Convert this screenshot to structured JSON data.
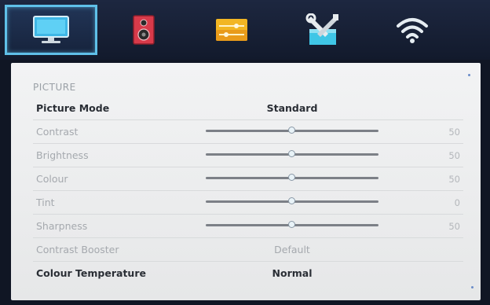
{
  "tabs": [
    {
      "icon": "monitor-icon",
      "active": true
    },
    {
      "icon": "speaker-icon",
      "active": false
    },
    {
      "icon": "equalizer-icon",
      "active": false
    },
    {
      "icon": "tools-icon",
      "active": false
    },
    {
      "icon": "wifi-icon",
      "active": false
    }
  ],
  "colors": {
    "accent": "#5fc0e8",
    "panel_bg": "#f0f1f2"
  },
  "section_title": "PICTURE",
  "picture_mode": {
    "label": "Picture Mode",
    "value": "Standard"
  },
  "sliders": [
    {
      "label": "Contrast",
      "value": "50",
      "fraction": 0.5
    },
    {
      "label": "Brightness",
      "value": "50",
      "fraction": 0.5
    },
    {
      "label": "Colour",
      "value": "50",
      "fraction": 0.5
    },
    {
      "label": "Tint",
      "value": "0",
      "fraction": 0.5
    },
    {
      "label": "Sharpness",
      "value": "50",
      "fraction": 0.5
    }
  ],
  "contrast_booster": {
    "label": "Contrast Booster",
    "value": "Default"
  },
  "colour_temperature": {
    "label": "Colour Temperature",
    "value": "Normal"
  }
}
